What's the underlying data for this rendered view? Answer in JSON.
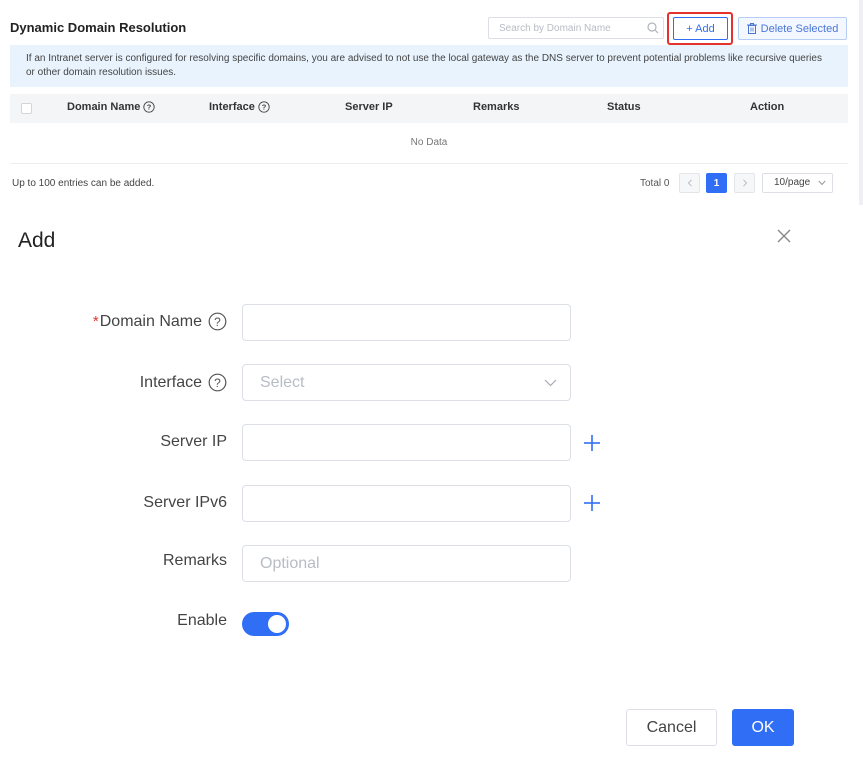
{
  "panel": {
    "title": "Dynamic Domain Resolution",
    "search": {
      "placeholder": "Search by Domain Name",
      "icon": "search-icon"
    },
    "add_button": "+ Add",
    "delete_button": "Delete Selected",
    "delete_icon": "trash-icon",
    "highlight_color": "#e5322d",
    "notice": "If an Intranet server is configured for resolving specific domains, you are advised to not use the local gateway as the DNS server to prevent potential problems like recursive queries or other domain resolution issues.",
    "columns": [
      {
        "label": "Domain Name",
        "help": true
      },
      {
        "label": "Interface",
        "help": true
      },
      {
        "label": "Server IP",
        "help": false
      },
      {
        "label": "Remarks",
        "help": false
      },
      {
        "label": "Status",
        "help": false
      },
      {
        "label": "Action",
        "help": false
      }
    ],
    "empty_text": "No Data",
    "footer_note": "Up to 100 entries can be added.",
    "pagination": {
      "total": "Total 0",
      "current_page": "1",
      "page_size": "10/page"
    }
  },
  "dialog": {
    "title": "Add",
    "close_icon": "close-icon",
    "fields": {
      "domain_name": {
        "label": "Domain Name",
        "required": true,
        "value": "",
        "placeholder": ""
      },
      "interface": {
        "label": "Interface",
        "placeholder": "Select"
      },
      "server_ip": {
        "label": "Server IP",
        "value": "",
        "placeholder": ""
      },
      "server_ipv6": {
        "label": "Server IPv6",
        "value": "",
        "placeholder": ""
      },
      "remarks": {
        "label": "Remarks",
        "value": "",
        "placeholder": "Optional"
      },
      "enable": {
        "label": "Enable",
        "on": true
      }
    },
    "cancel_button": "Cancel",
    "ok_button": "OK",
    "accent_color": "#2f6ef5"
  }
}
